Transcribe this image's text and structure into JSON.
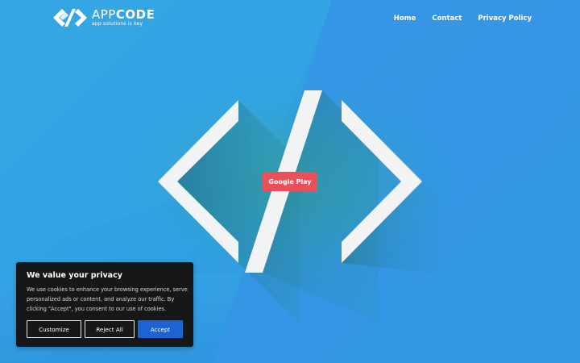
{
  "header": {
    "logo": {
      "name_light": "APP",
      "name_bold": "CODE",
      "tagline": "app solutions is key"
    },
    "nav": [
      {
        "label": "Home"
      },
      {
        "label": "Contact"
      },
      {
        "label": "Privacy Policy"
      }
    ]
  },
  "hero": {
    "cta_label": "Google Play"
  },
  "cookie_banner": {
    "title": "We value your privacy",
    "body": "We use cookies to enhance your browsing experience, serve personalized ads or content, and analyze our traffic. By clicking \"Accept\", you consent to our use of cookies.",
    "buttons": {
      "customize": "Customize",
      "reject": "Reject All",
      "accept": "Accept"
    }
  },
  "colors": {
    "background": "#35a6e4",
    "cta": "#e9505a",
    "accept": "#1d63d4",
    "banner": "#151719"
  }
}
